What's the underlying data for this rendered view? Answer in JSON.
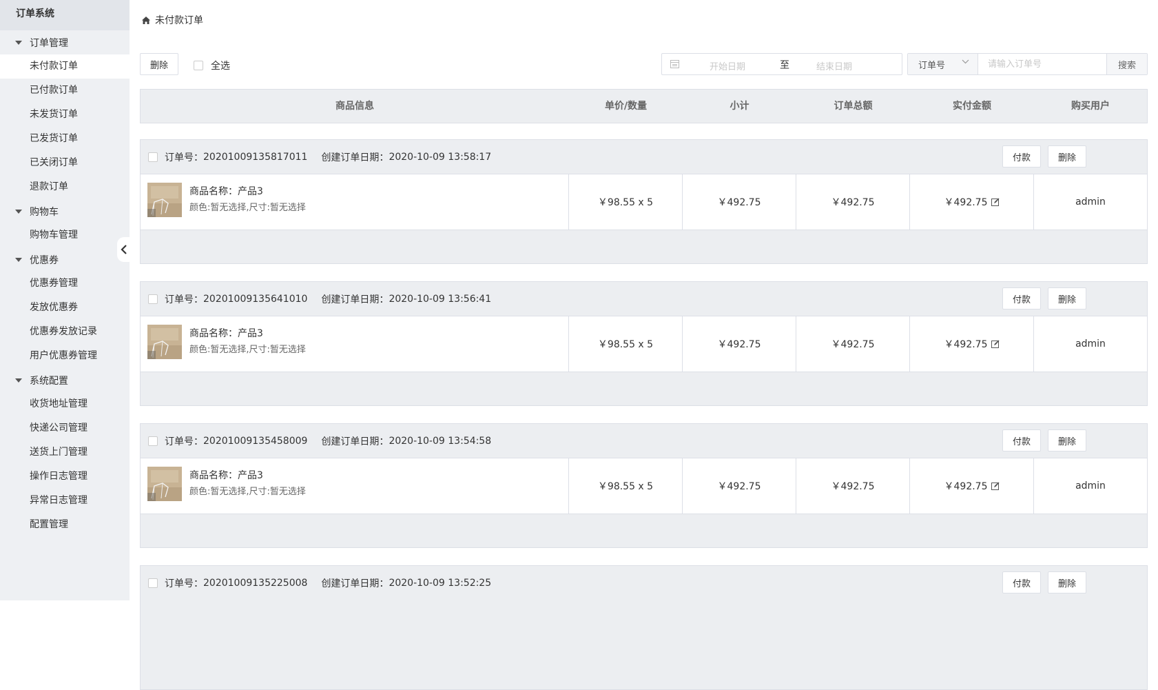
{
  "sidebar": {
    "title": "订单系统",
    "groups": [
      {
        "label": "订单管理",
        "items": [
          "未付款订单",
          "已付款订单",
          "未发货订单",
          "已发货订单",
          "已关闭订单",
          "退款订单"
        ]
      },
      {
        "label": "购物车",
        "items": [
          "购物车管理"
        ]
      },
      {
        "label": "优惠券",
        "items": [
          "优惠券管理",
          "发放优惠券",
          "优惠券发放记录",
          "用户优惠券管理"
        ]
      },
      {
        "label": "系统配置",
        "items": [
          "收货地址管理",
          "快递公司管理",
          "送货上门管理",
          "操作日志管理",
          "异常日志管理",
          "配置管理"
        ]
      }
    ]
  },
  "breadcrumb": {
    "current": "未付款订单"
  },
  "toolbar": {
    "delete_label": "删除",
    "select_all_label": "全选",
    "date_start_placeholder": "开始日期",
    "date_separator": "至",
    "date_end_placeholder": "结束日期",
    "search_field_selected": "订单号",
    "search_placeholder": "请输入订单号",
    "search_button": "搜索"
  },
  "table": {
    "headers": [
      "商品信息",
      "单价/数量",
      "小计",
      "订单总额",
      "实付金额",
      "购买用户"
    ]
  },
  "labels": {
    "order_no": "订单号：",
    "created_date": "创建订单日期：",
    "product_name": "商品名称：",
    "pay_button": "付款",
    "delete_button": "删除"
  },
  "orders": [
    {
      "order_no": "20201009135817011",
      "created": "2020-10-09 13:58:17",
      "product": "产品3",
      "attrs": "颜色:暂无选择,尺寸:暂无选择",
      "price_qty": "￥98.55 x 5",
      "subtotal": "￥492.75",
      "total": "￥492.75",
      "paid": "￥492.75",
      "user": "admin"
    },
    {
      "order_no": "20201009135641010",
      "created": "2020-10-09 13:56:41",
      "product": "产品3",
      "attrs": "颜色:暂无选择,尺寸:暂无选择",
      "price_qty": "￥98.55 x 5",
      "subtotal": "￥492.75",
      "total": "￥492.75",
      "paid": "￥492.75",
      "user": "admin"
    },
    {
      "order_no": "20201009135458009",
      "created": "2020-10-09 13:54:58",
      "product": "产品3",
      "attrs": "颜色:暂无选择,尺寸:暂无选择",
      "price_qty": "￥98.55 x 5",
      "subtotal": "￥492.75",
      "total": "￥492.75",
      "paid": "￥492.75",
      "user": "admin"
    },
    {
      "order_no": "20201009135225008",
      "created": "2020-10-09 13:52:25"
    }
  ]
}
